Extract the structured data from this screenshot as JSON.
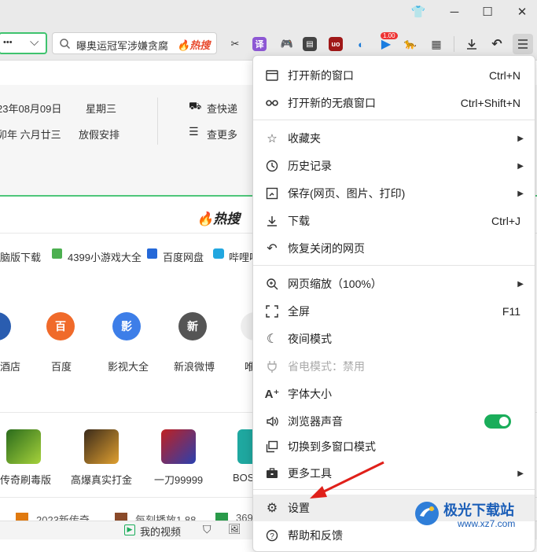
{
  "window": {
    "controls": {
      "skin": "👕",
      "minimize": "─",
      "maximize": "☐",
      "close": "✕"
    }
  },
  "toolbar": {
    "addr_dots": "•••",
    "addr_chevron": "⌵",
    "search_text": "曝奥运冠军涉嫌贪腐",
    "hot_label": "热搜",
    "badge": "1.00"
  },
  "page": {
    "date_line1": "23年08月09日",
    "weekday": "星期三",
    "date_line2": "卯年 六月廿三",
    "holiday": "放假安排",
    "express": "查快递",
    "more": "查更多",
    "hot_title": "热搜",
    "links": [
      "脑版下载",
      "4399小游戏大全",
      "百度网盘",
      "哔哩哔"
    ],
    "apps": [
      {
        "name": "酒店",
        "glyph": "",
        "color": "#2a5db0"
      },
      {
        "name": "百度",
        "glyph": "百",
        "color": "#f06a2a"
      },
      {
        "name": "影视大全",
        "glyph": "影",
        "color": "#3d7ee8"
      },
      {
        "name": "新浪微博",
        "glyph": "新",
        "color": "#555555"
      },
      {
        "name": "唯",
        "glyph": "",
        "color": "#cccccc"
      }
    ],
    "games": [
      "传奇刷毒版",
      "高爆真实打金",
      "一刀99999",
      "BOS"
    ],
    "bottom_items": [
      "2023新传奇",
      "每刻播放1.88",
      "369"
    ]
  },
  "statusbar": {
    "my_video": "我的视频"
  },
  "menu": {
    "items": [
      {
        "label": "打开新的窗口",
        "shortcut": "Ctrl+N",
        "icon": "window-icon"
      },
      {
        "label": "打开新的无痕窗口",
        "shortcut": "Ctrl+Shift+N",
        "icon": "incognito-icon"
      },
      {
        "label": "收藏夹",
        "icon": "star-icon"
      },
      {
        "label": "历史记录",
        "icon": "clock-icon"
      },
      {
        "label": "保存(网页、图片、打印)",
        "icon": "save-icon"
      },
      {
        "label": "下载",
        "shortcut": "Ctrl+J",
        "icon": "download-icon"
      },
      {
        "label": "恢复关闭的网页",
        "icon": "undo-icon"
      },
      {
        "label": "网页缩放（100%）",
        "icon": "zoom-icon"
      },
      {
        "label": "全屏",
        "shortcut": "F11",
        "icon": "fullscreen-icon"
      },
      {
        "label": "夜间模式",
        "icon": "moon-icon"
      },
      {
        "label": "省电模式：禁用",
        "icon": "plug-icon"
      },
      {
        "label": "字体大小",
        "icon": "font-size-icon"
      },
      {
        "label": "浏览器声音",
        "icon": "speaker-icon"
      },
      {
        "label": "切换到多窗口模式",
        "icon": "multi-window-icon"
      },
      {
        "label": "更多工具",
        "icon": "toolbox-icon"
      },
      {
        "label": "设置",
        "icon": "gear-icon"
      },
      {
        "label": "帮助和反馈",
        "icon": "help-icon"
      }
    ]
  },
  "watermark": {
    "brand": "极光下载站",
    "url": "www.xz7.com"
  }
}
